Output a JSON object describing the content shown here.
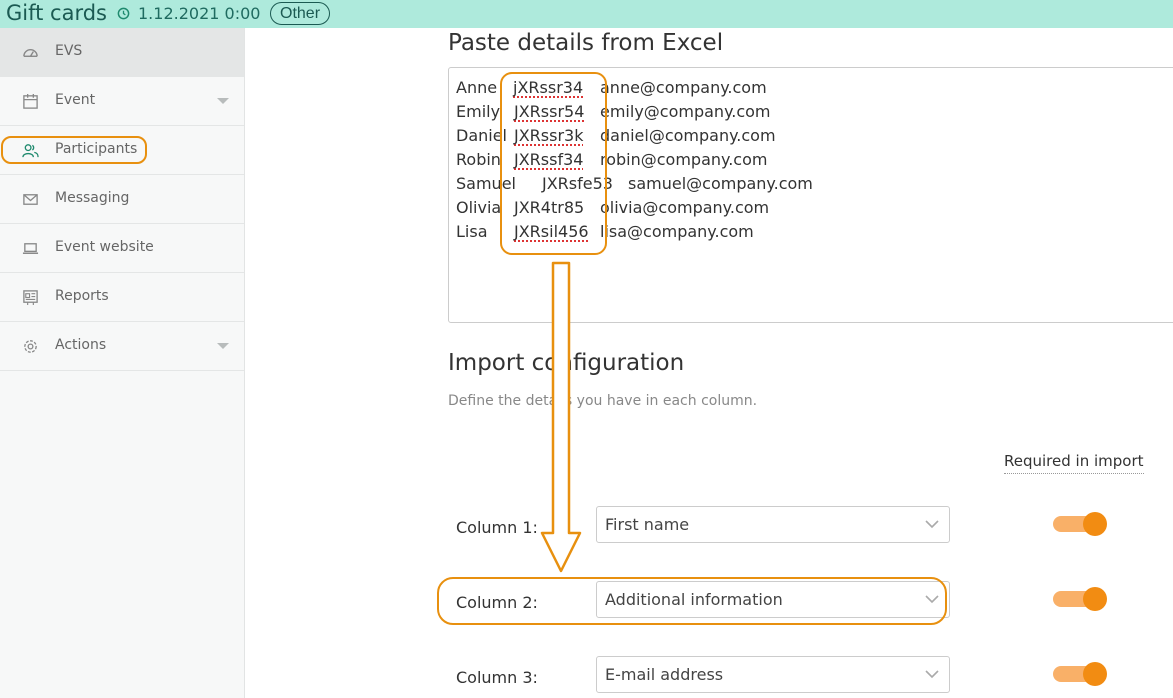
{
  "header": {
    "title": "Gift cards",
    "date": "1.12.2021 0:00",
    "badge": "Other"
  },
  "sidebar": {
    "items": [
      {
        "label": "EVS",
        "icon": "speedometer-icon",
        "active": true
      },
      {
        "label": "Event",
        "icon": "calendar-icon",
        "has_caret": true
      },
      {
        "label": "Participants",
        "icon": "people-icon",
        "highlighted": true
      },
      {
        "label": "Messaging",
        "icon": "envelope-icon"
      },
      {
        "label": "Event website",
        "icon": "laptop-icon"
      },
      {
        "label": "Reports",
        "icon": "report-icon"
      },
      {
        "label": "Actions",
        "icon": "gear-icon",
        "has_caret": true
      }
    ]
  },
  "paste": {
    "heading": "Paste details from Excel",
    "rows": [
      {
        "name": "Anne",
        "code": "jXRssr34",
        "email": "anne@company.com"
      },
      {
        "name": "Emily",
        "code": "JXRssr54",
        "email": "emily@company.com"
      },
      {
        "name": "Daniel",
        "code": "JXRssr3k",
        "email": "daniel@company.com"
      },
      {
        "name": "Robin",
        "code": "JXRssf34",
        "email": "robin@company.com"
      },
      {
        "name": "Samuel",
        "code": "JXRsfe53",
        "email": "samuel@company.com"
      },
      {
        "name": "Olivia",
        "code": "JXR4tr85",
        "email": "olivia@company.com"
      },
      {
        "name": "Lisa",
        "code": "JXRsil456",
        "email": "lisa@company.com"
      }
    ]
  },
  "import": {
    "heading": "Import configuration",
    "subtitle": "Define the details you have in each column.",
    "required_header": "Required in import",
    "columns": [
      {
        "label": "Column 1:",
        "value": "First name",
        "required": true
      },
      {
        "label": "Column 2:",
        "value": "Additional information",
        "required": true
      },
      {
        "label": "Column 3:",
        "value": "E-mail address",
        "required": true
      }
    ]
  },
  "colors": {
    "topbar": "#aeeadc",
    "highlight": "#e8900f",
    "toggle_on": "#f28c12"
  }
}
